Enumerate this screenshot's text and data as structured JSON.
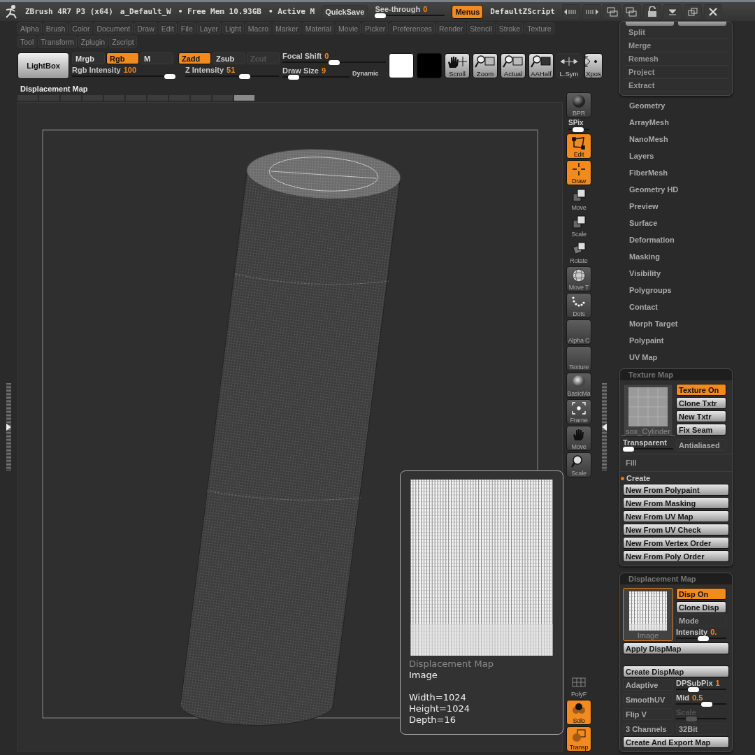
{
  "title_bar": {
    "app": "ZBrush 4R7 P3 (x64)",
    "document": "a_Default_W",
    "free_mem": "• Free Mem 10.93GB",
    "active_mem": "• Active M",
    "quicksave": "QuickSave",
    "see_through": {
      "label": "See-through",
      "value": "0",
      "level": 0
    },
    "menus": {
      "label": "Menus",
      "on": true
    },
    "script": "DefaultZScript"
  },
  "menu_rows": [
    [
      "Alpha",
      "Brush",
      "Color",
      "Document",
      "Draw",
      "Edit",
      "File",
      "Layer",
      "Light",
      "Macro",
      "Marker",
      "Material",
      "Movie",
      "Picker",
      "Preferences",
      "Render",
      "Stencil",
      "Stroke",
      "Texture"
    ],
    [
      "Tool",
      "Transform",
      "Zplugin",
      "Zscript"
    ]
  ],
  "top_shelf": {
    "lightbox": "LightBox",
    "color_modes": [
      {
        "label": "Mrgb",
        "on": false
      },
      {
        "label": "Rgb",
        "on": true
      },
      {
        "label": "M",
        "on": false
      }
    ],
    "depth_modes": [
      {
        "label": "Zadd",
        "on": true,
        "disabled": false
      },
      {
        "label": "Zsub",
        "on": false,
        "disabled": false
      },
      {
        "label": "Zcut",
        "on": false,
        "disabled": true
      }
    ],
    "rgb_intensity": {
      "label": "Rgb Intensity",
      "value": "100",
      "level": 1
    },
    "z_intensity": {
      "label": "Z Intensity",
      "value": "51",
      "level": 0.65
    },
    "focal_shift": {
      "label": "Focal Shift",
      "value": "0",
      "level": 0.5
    },
    "draw_size": {
      "label": "Draw Size",
      "value": "9",
      "level": 0.1
    },
    "dynamic": "Dynamic",
    "colors": [
      {
        "color": "#ffffff"
      },
      {
        "color": "#000000"
      }
    ],
    "view_buttons": [
      {
        "kind": "scroll",
        "label": "Scroll"
      },
      {
        "kind": "zoom",
        "label": "Zoom"
      },
      {
        "kind": "actual",
        "label": "Actual"
      },
      {
        "kind": "aahalf",
        "label": "AAHalf"
      },
      {
        "kind": "lsym",
        "label": "L.Sym"
      },
      {
        "kind": "xpos",
        "label": "Xpos"
      }
    ]
  },
  "document": {
    "title": "Displacement Map"
  },
  "right_shelf": {
    "upper_items": [
      {
        "kind": "sphere",
        "label": "BPR",
        "on": false
      },
      {
        "kind": "spix",
        "label": "SPix",
        "level": 0.4
      },
      {
        "kind": "edit",
        "label": "Edit",
        "on": true
      },
      {
        "kind": "draw",
        "label": "Draw",
        "on": true
      },
      {
        "kind": "move",
        "label": "Move",
        "on": false
      },
      {
        "kind": "scale",
        "label": "Scale",
        "on": false
      },
      {
        "kind": "rotate",
        "label": "Rotate",
        "on": false
      },
      {
        "kind": "mesh",
        "label": "Move T",
        "on": false
      },
      {
        "kind": "dots",
        "label": "Dots",
        "on": false
      },
      {
        "kind": "blank",
        "label": "Alpha C",
        "on": false
      },
      {
        "kind": "blank",
        "label": "Texture",
        "on": false
      },
      {
        "kind": "material",
        "label": "BasicMa",
        "on": false
      },
      {
        "kind": "frame",
        "label": "Frame",
        "on": false
      },
      {
        "kind": "hand",
        "label": "Move",
        "on": false
      },
      {
        "kind": "zoom",
        "label": "Scale",
        "on": false
      }
    ],
    "lower_items": [
      {
        "kind": "grid",
        "label": "PolyF",
        "on": false
      },
      {
        "kind": "solo",
        "label": "Solo",
        "on": true
      },
      {
        "kind": "transp",
        "label": "Transp",
        "on": true
      }
    ]
  },
  "popup": {
    "title": "Displacement Map",
    "name": "Image",
    "lines": [
      "Width=1024",
      "Height=1024",
      "Depth=16"
    ]
  },
  "tray": {
    "subtool_items": [
      "Split",
      "Merge",
      "Remesh",
      "Project",
      "Extract"
    ],
    "sections": [
      "Geometry",
      "ArrayMesh",
      "NanoMesh",
      "Layers",
      "FiberMesh",
      "Geometry HD",
      "Preview",
      "Surface",
      "Deformation",
      "Masking",
      "Visibility",
      "Polygroups",
      "Contact",
      "Morph Target",
      "Polypaint",
      "UV Map"
    ],
    "texture_map": {
      "title": "Texture Map",
      "thumbnail_caption": "_sox_Cylinder_",
      "buttons": [
        {
          "label": "Texture On",
          "on": true
        },
        {
          "label": "Clone Txtr",
          "on": false
        },
        {
          "label": "New Txtr",
          "on": false
        },
        {
          "label": "Fix Seam",
          "on": false
        }
      ],
      "transparent": {
        "label": "Transparent",
        "level": 0
      },
      "antialiased": {
        "label": "Antialiased",
        "on": false
      },
      "fill": "Fill",
      "create": "Create",
      "create_buttons": [
        "New From Polypaint",
        "New From Masking",
        "New From UV Map",
        "New From UV Check",
        "New From Vertex Order",
        "New From Poly Order"
      ]
    },
    "displacement_map": {
      "title": "Displacement Map",
      "thumbnail_caption": "Image",
      "buttons": [
        {
          "label": "Disp On",
          "on": true
        },
        {
          "label": "Clone Disp",
          "on": false
        }
      ],
      "mode": "Mode",
      "intensity": {
        "label": "Intensity",
        "value": "0.",
        "level": 0.55
      },
      "apply": "Apply DispMap",
      "create": "Create DispMap",
      "grid": [
        {
          "kind": "toggle",
          "label": "Adaptive",
          "on": false
        },
        {
          "kind": "slider",
          "label": "DPSubPix",
          "value": "1",
          "level": 0.3,
          "disabled": false
        },
        {
          "kind": "toggle",
          "label": "SmoothUV",
          "on": false
        },
        {
          "kind": "slider",
          "label": "Mid",
          "value": "0.5",
          "level": 0.65,
          "disabled": false
        },
        {
          "kind": "toggle",
          "label": "Flip V",
          "on": false
        },
        {
          "kind": "slider",
          "label": "Scale",
          "level": 0.25,
          "disabled": true
        },
        {
          "kind": "toggle",
          "label": "3 Channels",
          "on": false
        },
        {
          "kind": "toggle",
          "label": "32Bit",
          "on": false
        }
      ],
      "export": "Create And Export Map"
    }
  }
}
